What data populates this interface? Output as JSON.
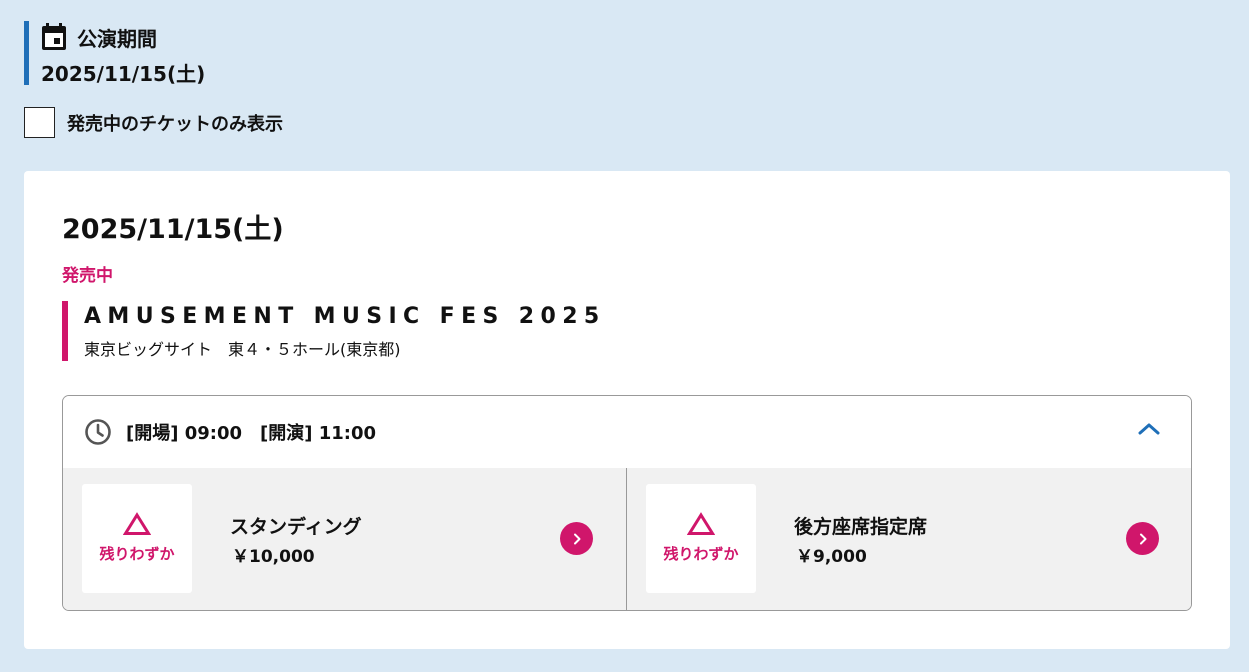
{
  "period": {
    "title": "公演期間",
    "date": "2025/11/15(土)"
  },
  "filter": {
    "label": "発売中のチケットのみ表示",
    "checked": false
  },
  "card": {
    "date": "2025/11/15(土)",
    "status": "発売中",
    "event_title": "AMUSEMENT MUSIC FES 2025",
    "venue": "東京ビッグサイト　東４・５ホール(東京都)"
  },
  "performance": {
    "times": "[開場] 09:00　[開演] 11:00",
    "expanded": true,
    "tickets": [
      {
        "availability": "残りわずか",
        "name": "スタンディング",
        "price": "￥10,000"
      },
      {
        "availability": "残りわずか",
        "name": "後方座席指定席",
        "price": "￥9,000"
      }
    ]
  },
  "colors": {
    "background": "#d9e8f4",
    "accent_blue": "#1f6fb8",
    "accent_pink": "#d0166b"
  },
  "icons": {
    "period": "calendar-icon",
    "time": "clock-icon",
    "collapse": "chevron-up-icon",
    "availability": "triangle-icon",
    "ticket_link": "chevron-right-icon"
  }
}
